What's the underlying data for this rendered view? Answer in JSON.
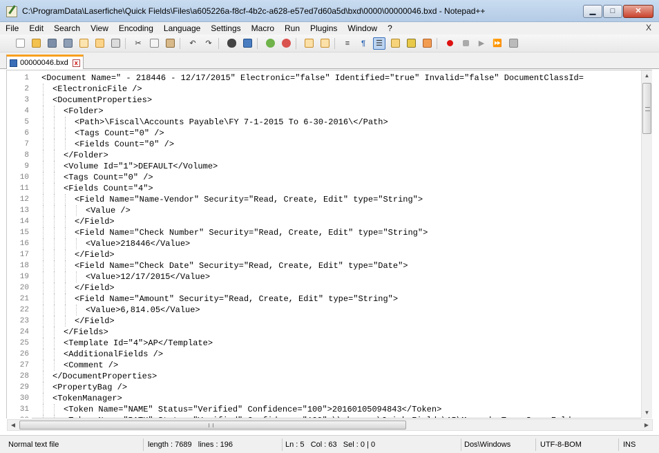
{
  "window": {
    "title": "C:\\ProgramData\\Laserfiche\\Quick Fields\\Files\\a605226a-f8cf-4b2c-a628-e57ed7d60a5d\\bxd\\0000\\00000046.bxd - Notepad++",
    "minimize": "▁",
    "maximize": "□",
    "close": "✕"
  },
  "menu": {
    "items": [
      "File",
      "Edit",
      "Search",
      "View",
      "Encoding",
      "Language",
      "Settings",
      "Macro",
      "Run",
      "Plugins",
      "Window",
      "?"
    ],
    "close_label": "X"
  },
  "toolbar": {
    "icons": [
      "new-file-icon",
      "open-file-icon",
      "save-icon",
      "save-all-icon",
      "close-icon",
      "close-all-icon",
      "print-icon",
      "cut-icon",
      "copy-icon",
      "paste-icon",
      "undo-icon",
      "redo-icon",
      "find-icon",
      "replace-icon",
      "zoom-in-icon",
      "zoom-out-icon",
      "sync-vertical-icon",
      "sync-horizontal-icon",
      "word-wrap-icon",
      "show-all-chars-icon",
      "indent-guide-icon",
      "udl-icon",
      "doc-map-icon",
      "function-list-icon",
      "record-macro-icon",
      "stop-macro-icon",
      "play-macro-icon",
      "run-macro-multiple-icon",
      "save-macro-icon"
    ]
  },
  "tab": {
    "name": "00000046.bxd",
    "close": "x"
  },
  "editor": {
    "lines": [
      {
        "n": "1",
        "indent": 0,
        "text": "<Document Name=\" - 218446 - 12/17/2015\" Electronic=\"false\" Identified=\"true\" Invalid=\"false\" DocumentClassId="
      },
      {
        "n": "2",
        "indent": 1,
        "text": "<ElectronicFile />"
      },
      {
        "n": "3",
        "indent": 1,
        "text": "<DocumentProperties>"
      },
      {
        "n": "4",
        "indent": 2,
        "text": "<Folder>"
      },
      {
        "n": "5",
        "indent": 3,
        "text": "<Path>\\Fiscal\\Accounts Payable\\FY 7-1-2015 To 6-30-2016\\</Path>"
      },
      {
        "n": "6",
        "indent": 3,
        "text": "<Tags Count=\"0\" />"
      },
      {
        "n": "7",
        "indent": 3,
        "text": "<Fields Count=\"0\" />"
      },
      {
        "n": "8",
        "indent": 2,
        "text": "</Folder>"
      },
      {
        "n": "9",
        "indent": 2,
        "text": "<Volume Id=\"1\">DEFAULT</Volume>"
      },
      {
        "n": "10",
        "indent": 2,
        "text": "<Tags Count=\"0\" />"
      },
      {
        "n": "11",
        "indent": 2,
        "text": "<Fields Count=\"4\">"
      },
      {
        "n": "12",
        "indent": 3,
        "text": "<Field Name=\"Name-Vendor\" Security=\"Read, Create, Edit\" type=\"String\">"
      },
      {
        "n": "13",
        "indent": 4,
        "text": "<Value />"
      },
      {
        "n": "14",
        "indent": 3,
        "text": "</Field>"
      },
      {
        "n": "15",
        "indent": 3,
        "text": "<Field Name=\"Check Number\" Security=\"Read, Create, Edit\" type=\"String\">"
      },
      {
        "n": "16",
        "indent": 4,
        "text": "<Value>218446</Value>"
      },
      {
        "n": "17",
        "indent": 3,
        "text": "</Field>"
      },
      {
        "n": "18",
        "indent": 3,
        "text": "<Field Name=\"Check Date\" Security=\"Read, Create, Edit\" type=\"Date\">"
      },
      {
        "n": "19",
        "indent": 4,
        "text": "<Value>12/17/2015</Value>"
      },
      {
        "n": "20",
        "indent": 3,
        "text": "</Field>"
      },
      {
        "n": "21",
        "indent": 3,
        "text": "<Field Name=\"Amount\" Security=\"Read, Create, Edit\" type=\"String\">"
      },
      {
        "n": "22",
        "indent": 4,
        "text": "<Value>6,814.05</Value>"
      },
      {
        "n": "23",
        "indent": 3,
        "text": "</Field>"
      },
      {
        "n": "24",
        "indent": 2,
        "text": "</Fields>"
      },
      {
        "n": "25",
        "indent": 2,
        "text": "<Template Id=\"4\">AP</Template>"
      },
      {
        "n": "26",
        "indent": 2,
        "text": "<AdditionalFields />"
      },
      {
        "n": "27",
        "indent": 2,
        "text": "<Comment />"
      },
      {
        "n": "28",
        "indent": 1,
        "text": "</DocumentProperties>"
      },
      {
        "n": "29",
        "indent": 1,
        "text": "<PropertyBag />"
      },
      {
        "n": "30",
        "indent": 1,
        "text": "<TokenManager>"
      },
      {
        "n": "31",
        "indent": 2,
        "text": "<Token Name=\"NAME\" Status=\"Verified\" Confidence=\"100\">20160105094843</Token>"
      },
      {
        "n": "32",
        "indent": 2,
        "text": "<Token Name=\"PATH\" Status=\"Verified\" Confidence=\"100\">\\\\ghsrosc\\Quick Fields\\AP\\Maronda Temp Scan Folder"
      }
    ]
  },
  "status": {
    "file_type": "Normal text file",
    "length": "length : 7689",
    "lines": "lines : 196",
    "ln": "Ln : 5",
    "col": "Col : 63",
    "sel": "Sel : 0 | 0",
    "eol": "Dos\\Windows",
    "encoding": "UTF-8-BOM",
    "mode": "INS"
  }
}
